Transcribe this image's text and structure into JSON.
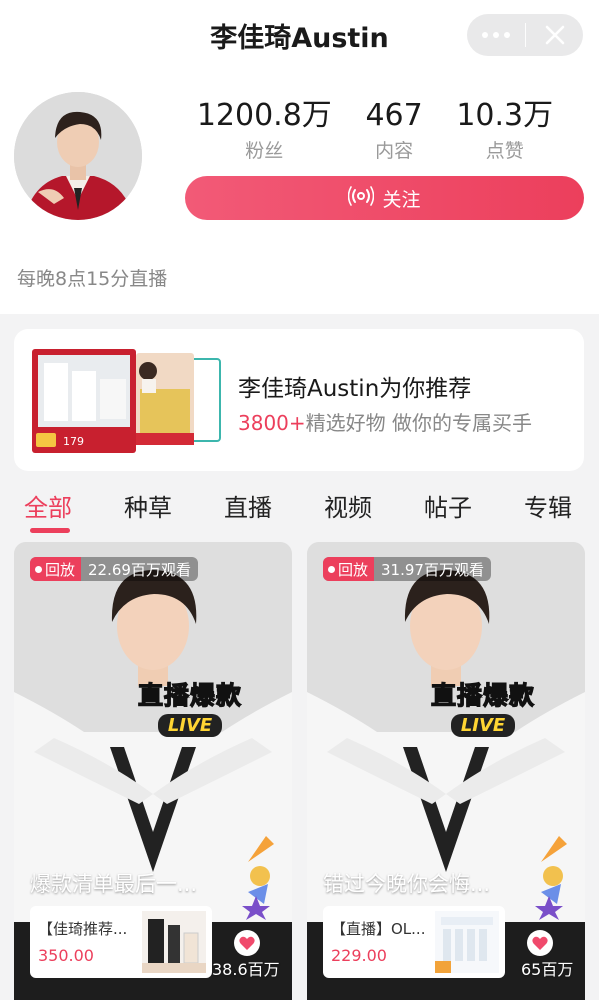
{
  "header": {
    "title": "李佳琦Austin"
  },
  "profile": {
    "stats": [
      {
        "value": "1200.8万",
        "label": "粉丝"
      },
      {
        "value": "467",
        "label": "内容"
      },
      {
        "value": "10.3万",
        "label": "点赞"
      }
    ],
    "follow_label": "关注",
    "live_schedule": "每晚8点15分直播"
  },
  "recommend": {
    "title": "李佳琦Austin为你推荐",
    "count": "3800+",
    "subtitle": "精选好物 做你的专属买手",
    "thumb_price": "179"
  },
  "tabs": [
    "全部",
    "种草",
    "直播",
    "视频",
    "帖子",
    "专辑"
  ],
  "cards": [
    {
      "badge": "回放",
      "views": "22.69百万观看",
      "live_title_white": "直播",
      "live_title_yellow": "爆款",
      "live_tag": "LIVE",
      "caption": "爆款清单最后一...",
      "product_name": "【佳琦推荐...",
      "product_price": "350.00",
      "likes": "38.6百万"
    },
    {
      "badge": "回放",
      "views": "31.97百万观看",
      "live_title_white": "直播",
      "live_title_yellow": "爆款",
      "live_tag": "LIVE",
      "caption": "错过今晚你会悔...",
      "product_name": "【直播】OL...",
      "product_price": "229.00",
      "likes": "65百万"
    }
  ],
  "colors": {
    "accent": "#ec3f5c",
    "background": "#f3f3f4"
  }
}
